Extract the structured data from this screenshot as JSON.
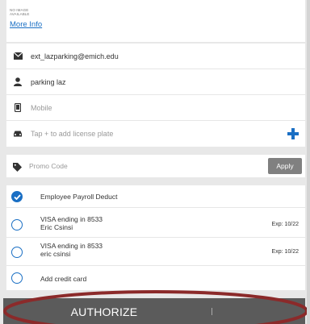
{
  "info": {
    "no_image_line1": "NO IMAGE",
    "no_image_line2": "AVAILABLE",
    "more_info": "More Info"
  },
  "user": {
    "email": "ext_lazparking@emich.edu",
    "name": "parking laz",
    "mobile_placeholder": "Mobile",
    "plate_placeholder": "Tap + to add license plate"
  },
  "promo": {
    "placeholder": "Promo Code",
    "apply_label": "Apply"
  },
  "payment": {
    "payroll_label": "Employee Payroll Deduct",
    "card1_line1": "VISA ending in 8533",
    "card1_line2": "Eric Csinsi",
    "card1_exp": "Exp: 10/22",
    "card2_line1": "VISA ending in 8533",
    "card2_line2": "eric csinsi",
    "card2_exp": "Exp: 10/22",
    "add_card_label": "Add credit card"
  },
  "footer": {
    "authorize_label": "AUTHORIZE"
  },
  "colors": {
    "accent": "#1a6fc4",
    "annotation": "#8b2a2a",
    "authorize_bg": "#5b5b5b"
  },
  "icons": [
    "envelope-icon",
    "person-icon",
    "phone-icon",
    "car-icon",
    "plus-icon",
    "tag-icon",
    "check-icon"
  ]
}
